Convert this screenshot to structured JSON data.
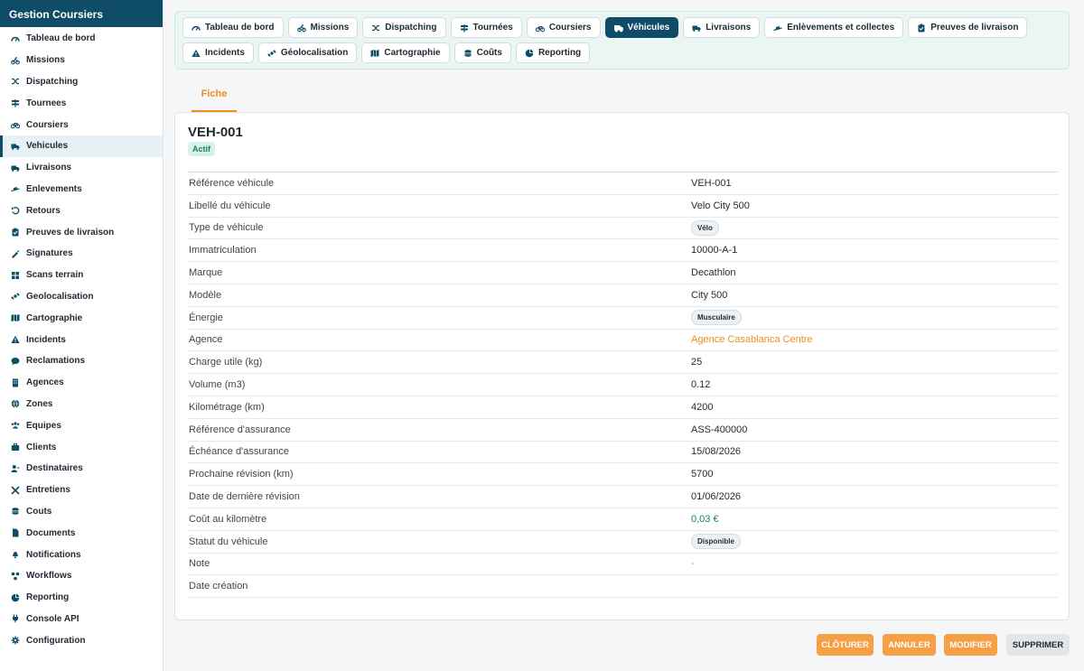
{
  "app": {
    "title": "Gestion Coursiers"
  },
  "sidebar": {
    "items": [
      {
        "label": "Tableau de bord",
        "icon": "gauge-icon"
      },
      {
        "label": "Missions",
        "icon": "bike-icon"
      },
      {
        "label": "Dispatching",
        "icon": "shuffle-icon"
      },
      {
        "label": "Tournees",
        "icon": "signpost-icon"
      },
      {
        "label": "Coursiers",
        "icon": "bicycle-icon"
      },
      {
        "label": "Vehicules",
        "icon": "truck-icon",
        "active": true
      },
      {
        "label": "Livraisons",
        "icon": "truck-icon"
      },
      {
        "label": "Enlevements",
        "icon": "dolly-icon"
      },
      {
        "label": "Retours",
        "icon": "undo-icon"
      },
      {
        "label": "Preuves de livraison",
        "icon": "clipboard-check-icon"
      },
      {
        "label": "Signatures",
        "icon": "signature-icon"
      },
      {
        "label": "Scans terrain",
        "icon": "barcode-icon"
      },
      {
        "label": "Geolocalisation",
        "icon": "satellite-icon"
      },
      {
        "label": "Cartographie",
        "icon": "map-icon"
      },
      {
        "label": "Incidents",
        "icon": "warning-icon"
      },
      {
        "label": "Reclamations",
        "icon": "comment-icon"
      },
      {
        "label": "Agences",
        "icon": "building-icon"
      },
      {
        "label": "Zones",
        "icon": "globe-icon"
      },
      {
        "label": "Equipes",
        "icon": "users-icon"
      },
      {
        "label": "Clients",
        "icon": "briefcase-icon"
      },
      {
        "label": "Destinataires",
        "icon": "user-tag-icon"
      },
      {
        "label": "Entretiens",
        "icon": "tools-icon"
      },
      {
        "label": "Couts",
        "icon": "coins-icon"
      },
      {
        "label": "Documents",
        "icon": "file-icon"
      },
      {
        "label": "Notifications",
        "icon": "bell-icon"
      },
      {
        "label": "Workflows",
        "icon": "workflow-icon"
      },
      {
        "label": "Reporting",
        "icon": "pie-chart-icon"
      },
      {
        "label": "Console API",
        "icon": "plug-icon"
      },
      {
        "label": "Configuration",
        "icon": "gear-icon"
      }
    ]
  },
  "tabs": [
    {
      "label": "Tableau de bord",
      "icon": "gauge-icon"
    },
    {
      "label": "Missions",
      "icon": "bike-icon"
    },
    {
      "label": "Dispatching",
      "icon": "shuffle-icon"
    },
    {
      "label": "Tournées",
      "icon": "signpost-icon"
    },
    {
      "label": "Coursiers",
      "icon": "bicycle-icon"
    },
    {
      "label": "Véhicules",
      "icon": "truck-icon",
      "active": true
    },
    {
      "label": "Livraisons",
      "icon": "truck-icon"
    },
    {
      "label": "Enlèvements et collectes",
      "icon": "dolly-icon"
    },
    {
      "label": "Preuves de livraison",
      "icon": "clipboard-check-icon"
    },
    {
      "label": "Incidents",
      "icon": "warning-icon"
    },
    {
      "label": "Géolocalisation",
      "icon": "satellite-icon"
    },
    {
      "label": "Cartographie",
      "icon": "map-icon"
    },
    {
      "label": "Coûts",
      "icon": "coins-icon"
    },
    {
      "label": "Reporting",
      "icon": "pie-chart-icon"
    }
  ],
  "subtab": {
    "label": "Fiche"
  },
  "record": {
    "title": "VEH-001",
    "status": "Actif",
    "fields": [
      {
        "label": "Référence véhicule",
        "value": "VEH-001"
      },
      {
        "label": "Libellé du véhicule",
        "value": "Velo City 500"
      },
      {
        "label": "Type de véhicule",
        "value": "Vélo",
        "kind": "badge"
      },
      {
        "label": "Immatriculation",
        "value": "10000-A-1"
      },
      {
        "label": "Marque",
        "value": "Decathlon"
      },
      {
        "label": "Modèle",
        "value": "City 500"
      },
      {
        "label": "Énergie",
        "value": "Musculaire",
        "kind": "badge"
      },
      {
        "label": "Agence",
        "value": "Agence Casablanca Centre",
        "kind": "link"
      },
      {
        "label": "Charge utile (kg)",
        "value": "25"
      },
      {
        "label": "Volume (m3)",
        "value": "0.12"
      },
      {
        "label": "Kilométrage (km)",
        "value": "4200"
      },
      {
        "label": "Référence d'assurance",
        "value": "ASS-400000"
      },
      {
        "label": "Échéance d'assurance",
        "value": "15/08/2026"
      },
      {
        "label": "Prochaine révision (km)",
        "value": "5700"
      },
      {
        "label": "Date de dernière révision",
        "value": "01/06/2026"
      },
      {
        "label": "Coût au kilomètre",
        "value": "0,03 €",
        "kind": "money"
      },
      {
        "label": "Statut du véhicule",
        "value": "Disponible",
        "kind": "badge"
      },
      {
        "label": "Note",
        "value": "-",
        "kind": "muted"
      },
      {
        "label": "Date création",
        "value": ""
      }
    ]
  },
  "actions": {
    "close_label": "CLÔTURER",
    "cancel_label": "ANNULER",
    "edit_label": "MODIFIER",
    "delete_label": "SUPPRIMER"
  },
  "colors": {
    "brand": "#0f4c68",
    "accent": "#f08c1e",
    "success": "#17806a"
  }
}
